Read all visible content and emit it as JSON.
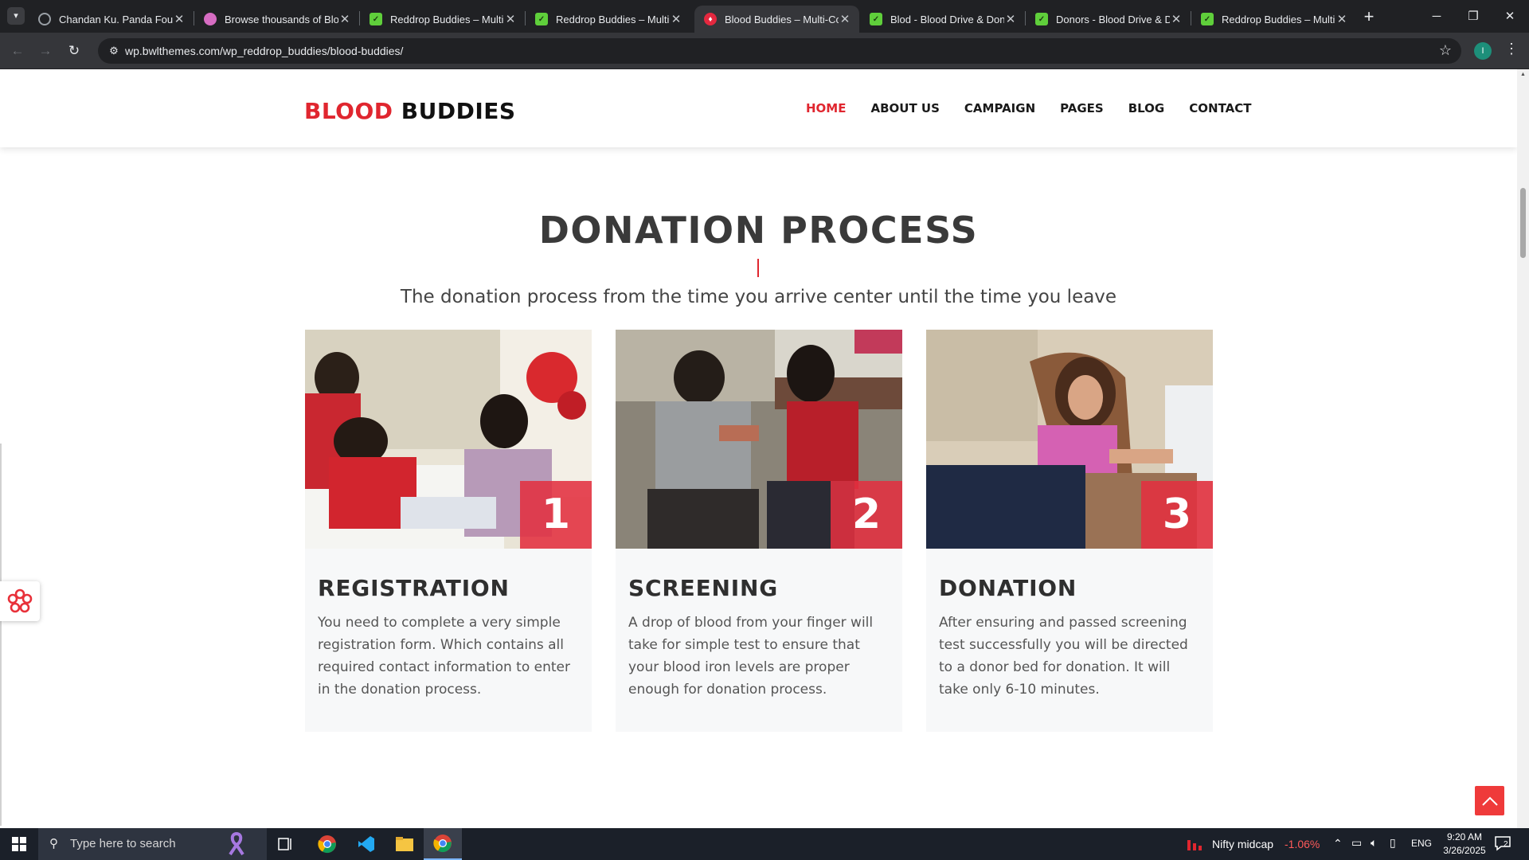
{
  "browser": {
    "tabs": [
      {
        "title": "Chandan Ku. Panda Found",
        "favicon": "globe-icon",
        "active": false
      },
      {
        "title": "Browse thousands of Bloo",
        "favicon": "dribbble-icon",
        "active": false
      },
      {
        "title": "Reddrop Buddies – Multi-",
        "favicon": "envato-icon",
        "active": false
      },
      {
        "title": "Reddrop Buddies – Multi-",
        "favicon": "envato-icon",
        "active": false
      },
      {
        "title": "Blood Buddies – Multi-Co",
        "favicon": "blood-buddies-icon",
        "active": true
      },
      {
        "title": "Blod - Blood Drive & Don",
        "favicon": "envato-icon",
        "active": false
      },
      {
        "title": "Donors - Blood Drive & D",
        "favicon": "envato-icon",
        "active": false
      },
      {
        "title": "Reddrop Buddies – Multi-",
        "favicon": "envato-icon",
        "active": false
      }
    ],
    "url": "wp.bwlthemes.com/wp_reddrop_buddies/blood-buddies/",
    "profile_initial": "I"
  },
  "site": {
    "logo_part1": "BLOOD",
    "logo_part2": "BUDDIES",
    "nav": [
      {
        "label": "HOME",
        "active": true
      },
      {
        "label": "ABOUT US",
        "active": false
      },
      {
        "label": "CAMPAIGN",
        "active": false
      },
      {
        "label": "PAGES",
        "active": false
      },
      {
        "label": "BLOG",
        "active": false
      },
      {
        "label": "CONTACT",
        "active": false
      }
    ],
    "accent_color": "#e0262f"
  },
  "section": {
    "title": "DONATION PROCESS",
    "subtitle": "The donation process from the time you arrive center until the time you leave"
  },
  "steps": [
    {
      "number": "1",
      "title": "REGISTRATION",
      "text": "You need to complete a very simple registration form. Which contains all required contact information to enter in the donation process."
    },
    {
      "number": "2",
      "title": "SCREENING",
      "text": "A drop of blood from your finger will take for simple test to ensure that your blood iron levels are proper enough for donation process."
    },
    {
      "number": "3",
      "title": "DONATION",
      "text": "After ensuring and passed screening test successfully you will be directed to a donor bed for donation. It will take only 6-10 minutes."
    }
  ],
  "taskbar": {
    "search_placeholder": "Type here to search",
    "stock_name": "Nifty midcap",
    "stock_change": "-1.06%",
    "language": "ENG",
    "time": "9:20 AM",
    "date": "3/26/2025",
    "notification_count": "2"
  }
}
